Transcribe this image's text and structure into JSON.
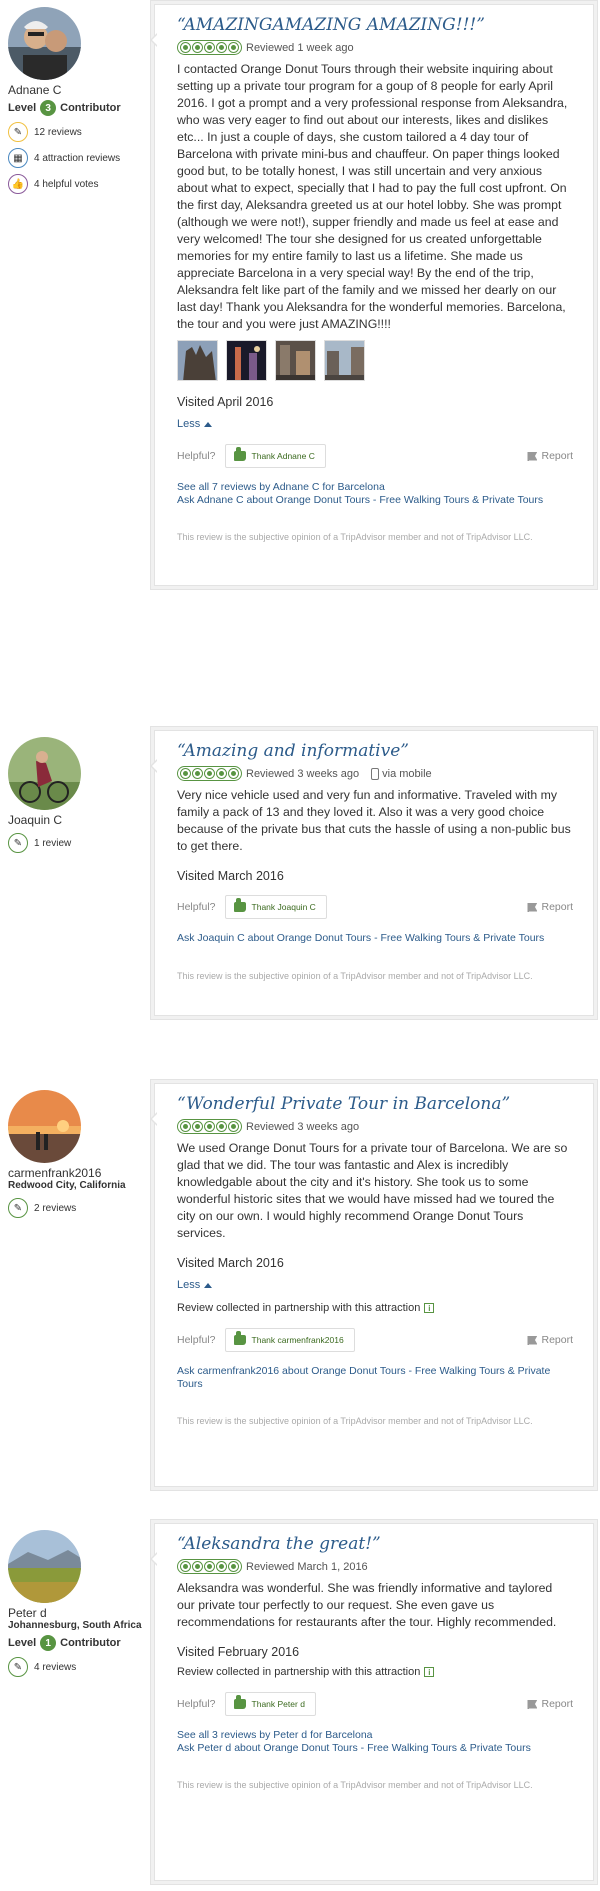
{
  "reviews": [
    {
      "user": {
        "name": "Adnane C",
        "location": "",
        "level_label": "Level",
        "level_num": "3",
        "contributor_label": "Contributor",
        "stats": [
          {
            "icon": "pencil-icon",
            "text": "12 reviews"
          },
          {
            "icon": "attraction-icon",
            "text": "4 attraction reviews"
          },
          {
            "icon": "thumbs-up-icon",
            "text": "4 helpful votes"
          }
        ]
      },
      "title": "“AMAZINGAMAZING AMAZING!!!”",
      "rating": 5,
      "reviewed": "Reviewed 1 week ago",
      "via": "",
      "body": "I contacted Orange Donut Tours through their website inquiring about setting up a private tour program for a goup of 8 people for early April 2016. I got a prompt and a very professional response from Aleksandra, who was very eager to find out about our interests, likes and dislikes etc... In just a couple of days, she custom tailored a 4 day tour of Barcelona with private mini-bus and chauffeur. On paper things looked good but, to be totally honest, I was still uncertain and very anxious about what to expect, specially that I had to pay the full cost upfront. On the first day, Aleksandra greeted us at our hotel lobby. She was prompt (although we were not!), supper friendly and made us feel at ease and very welcomed! The tour she designed for us created unforgettable memories for my entire family to last us a lifetime. She made us appreciate Barcelona in a very special way! By the end of the trip, Aleksandra felt like part of the family and we missed her dearly on our last day! Thank you Aleksandra for the wonderful memories. Barcelona, the tour and you were just AMAZING!!!!",
      "visited": "Visited April 2016",
      "less": "Less",
      "collected": "",
      "helpful": "Helpful?",
      "thank": "Thank Adnane C",
      "report": "Report",
      "links": [
        "See all 7 reviews by Adnane C for Barcelona",
        "Ask Adnane C about Orange Donut Tours - Free Walking Tours & Private Tours"
      ],
      "disclaimer": "This review is the subjective opinion of a TripAdvisor member and not of TripAdvisor LLC."
    },
    {
      "user": {
        "name": "Joaquin C",
        "location": "",
        "level_label": "",
        "level_num": "",
        "contributor_label": "",
        "stats": [
          {
            "icon": "pencil-icon",
            "text": "1 review"
          }
        ]
      },
      "title": "“Amazing and informative”",
      "rating": 5,
      "reviewed": "Reviewed 3 weeks ago",
      "via": "via mobile",
      "body": "Very nice vehicle used and very fun and informative. Traveled with my family a pack of 13 and they loved it. Also it was a very good choice because of the private bus that cuts the hassle of using a non-public bus to get there.",
      "visited": "Visited March 2016",
      "less": "",
      "collected": "",
      "helpful": "Helpful?",
      "thank": "Thank Joaquin C",
      "report": "Report",
      "links": [
        "Ask Joaquin C about Orange Donut Tours - Free Walking Tours & Private Tours"
      ],
      "disclaimer": "This review is the subjective opinion of a TripAdvisor member and not of TripAdvisor LLC."
    },
    {
      "user": {
        "name": "carmenfrank2016",
        "location": "Redwood City, California",
        "level_label": "",
        "level_num": "",
        "contributor_label": "",
        "stats": [
          {
            "icon": "pencil-icon",
            "text": "2 reviews"
          }
        ]
      },
      "title": "“Wonderful Private Tour in Barcelona”",
      "rating": 5,
      "reviewed": "Reviewed 3 weeks ago",
      "via": "",
      "body": "We used Orange Donut Tours for a private tour of Barcelona. We are so glad that we did. The tour was fantastic and Alex is incredibly knowledgable about the city and it's history. She took us to some wonderful historic sites that we would have missed had we toured the city on our own. I would highly recommend Orange Donut Tours services.",
      "visited": "Visited March 2016",
      "less": "Less",
      "collected": "Review collected in partnership with this attraction",
      "helpful": "Helpful?",
      "thank": "Thank carmenfrank2016",
      "report": "Report",
      "links": [
        "Ask carmenfrank2016 about Orange Donut Tours - Free Walking Tours & Private Tours"
      ],
      "disclaimer": "This review is the subjective opinion of a TripAdvisor member and not of TripAdvisor LLC."
    },
    {
      "user": {
        "name": "Peter d",
        "location": "Johannesburg, South Africa",
        "level_label": "Level",
        "level_num": "1",
        "contributor_label": "Contributor",
        "stats": [
          {
            "icon": "pencil-icon",
            "text": "4 reviews"
          }
        ]
      },
      "title": "“Aleksandra the great!”",
      "rating": 5,
      "reviewed": "Reviewed March 1, 2016",
      "via": "",
      "body": "Aleksandra was wonderful. She was friendly informative and taylored our private tour perfectly to our request. She even gave us recommendations for restaurants after the tour. Highly recommended.",
      "visited": "Visited February 2016",
      "less": "",
      "collected": "Review collected in partnership with this attraction",
      "helpful": "Helpful?",
      "thank": "Thank Peter d",
      "report": "Report",
      "links": [
        "See all 3 reviews by Peter d for Barcelona",
        "Ask Peter d about Orange Donut Tours - Free Walking Tours & Private Tours"
      ],
      "disclaimer": "This review is the subjective opinion of a TripAdvisor member and not of TripAdvisor LLC."
    }
  ],
  "colors": {
    "link": "#2c5b8a",
    "rating_green": "#589442",
    "border": "#e3e3e3"
  }
}
